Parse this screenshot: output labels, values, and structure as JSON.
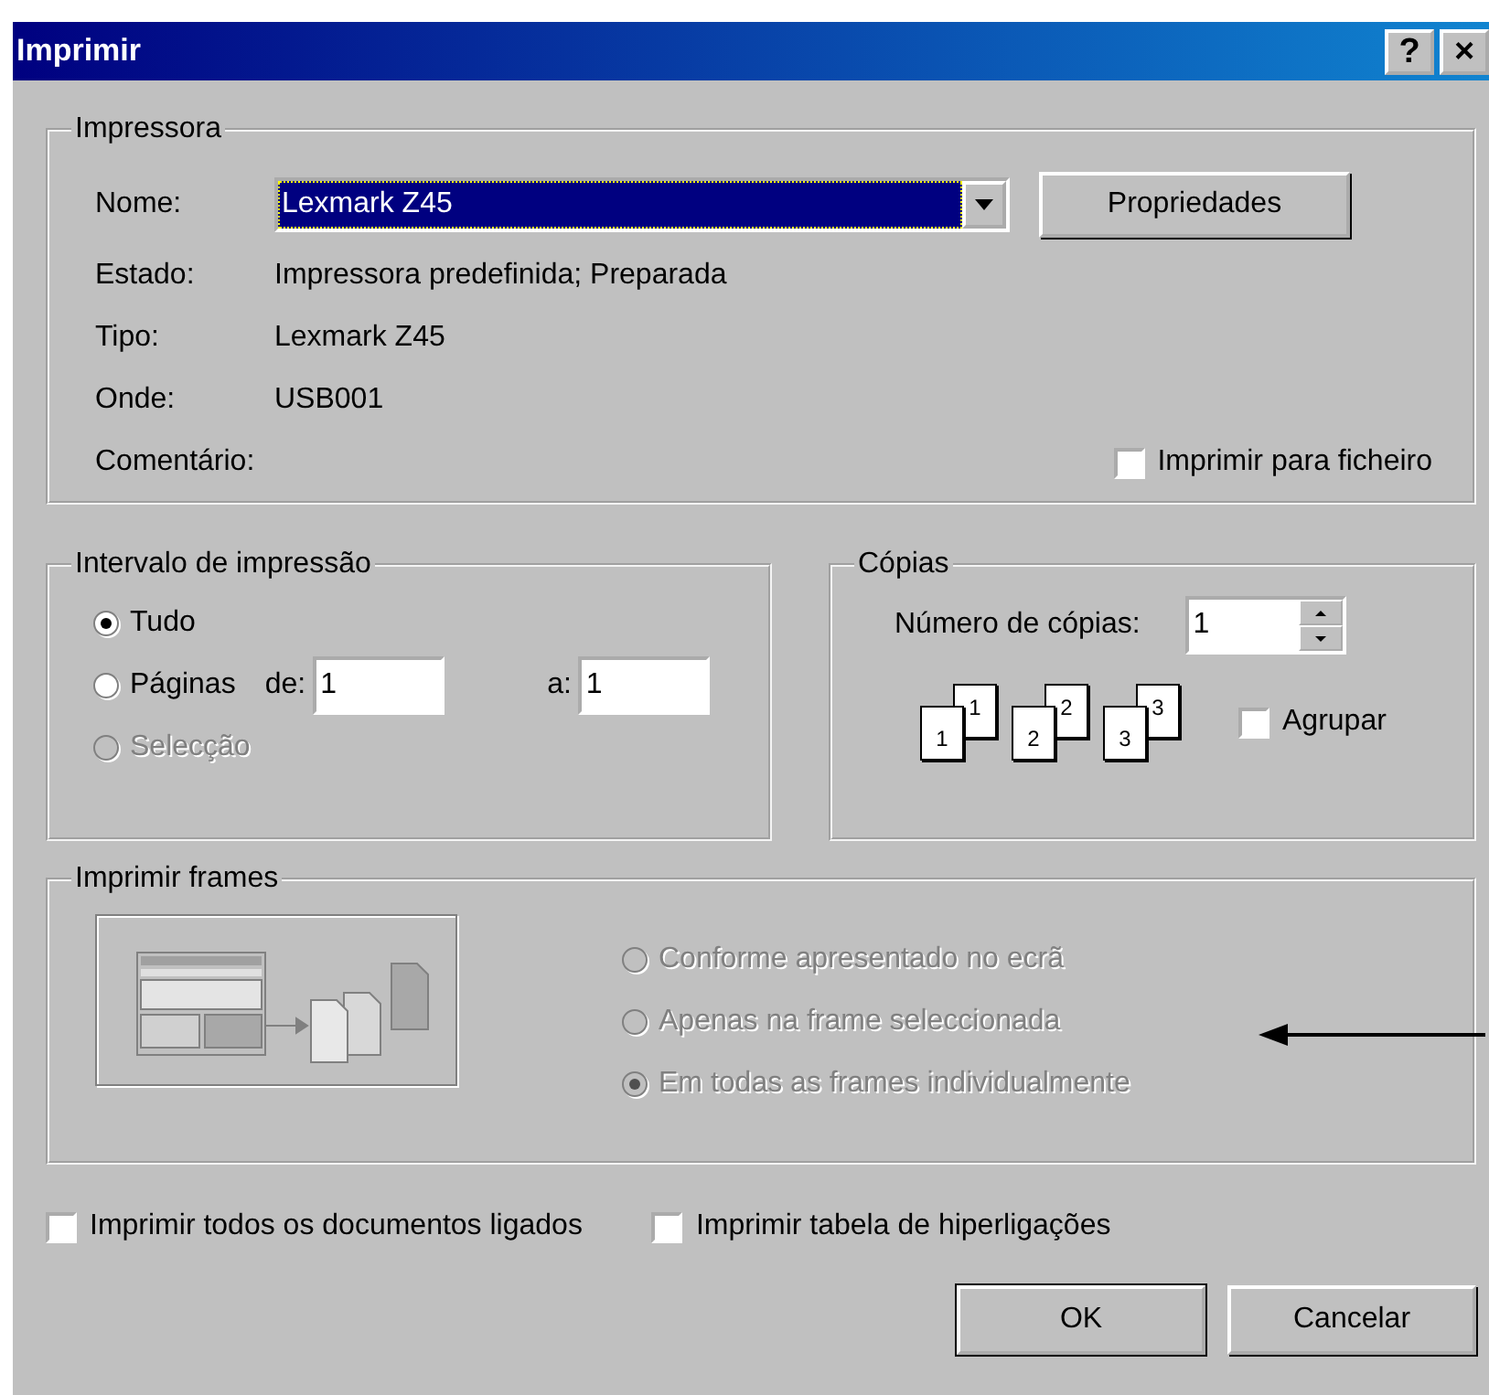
{
  "window": {
    "title": "Imprimir",
    "help_button": "?",
    "close_button": "×"
  },
  "printer": {
    "title": "Impressora",
    "name_label": "Nome:",
    "name_value": "Lexmark Z45",
    "properties_button": "Propriedades",
    "info": [
      {
        "label": "Estado:",
        "value": "Impressora predefinida; Preparada"
      },
      {
        "label": "Tipo:",
        "value": "Lexmark Z45"
      },
      {
        "label": "Onde:",
        "value": "USB001"
      },
      {
        "label": "Comentário:"
      }
    ],
    "print_to_file": {
      "label": "Imprimir para ficheiro",
      "checked": false
    }
  },
  "range": {
    "title": "Intervalo de impressão",
    "options": [
      {
        "label": "Tudo",
        "selected": true,
        "disabled": false
      },
      {
        "label": "Páginas",
        "selected": false,
        "disabled": false
      },
      {
        "label": "Selecção",
        "selected": false,
        "disabled": true
      }
    ],
    "from_label": "de:",
    "from_value": "1",
    "to_label": "a:",
    "to_value": "1"
  },
  "copies": {
    "title": "Cópias",
    "count_label": "Número de cópias:",
    "count_value": "1",
    "collate_pages": [
      {
        "back": "1",
        "front": "1"
      },
      {
        "back": "2",
        "front": "2"
      },
      {
        "back": "3",
        "front": "3"
      }
    ],
    "collate": {
      "label": "Agrupar",
      "checked": false
    }
  },
  "frames": {
    "title": "Imprimir frames",
    "options": [
      {
        "label": "Conforme apresentado no ecrã",
        "selected": false,
        "disabled": true
      },
      {
        "label": "Apenas na frame seleccionada",
        "selected": false,
        "disabled": true
      },
      {
        "label": "Em todas as frames individualmente",
        "selected": true,
        "disabled": true
      }
    ]
  },
  "options": [
    {
      "label": "Imprimir todos os documentos ligados",
      "checked": false
    },
    {
      "label": "Imprimir tabela de hiperligações",
      "checked": false
    }
  ],
  "buttons": [
    {
      "label": "OK",
      "default": true
    },
    {
      "label": "Cancelar",
      "default": false
    }
  ]
}
